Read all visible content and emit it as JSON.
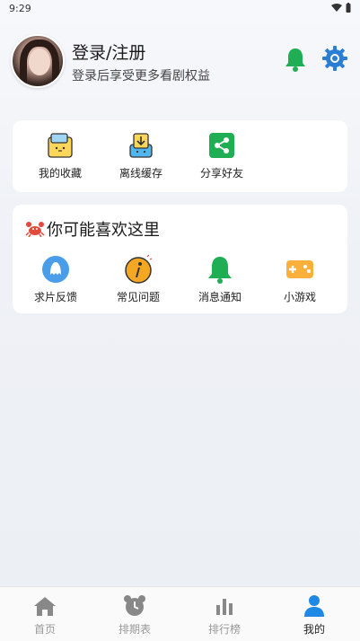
{
  "status_bar": {
    "time": "9:29"
  },
  "profile": {
    "title": "登录/注册",
    "subtitle": "登录后享受更多看剧权益"
  },
  "quick_actions": [
    {
      "label": "我的收藏",
      "icon": "folder-icon"
    },
    {
      "label": "离线缓存",
      "icon": "download-icon"
    },
    {
      "label": "分享好友",
      "icon": "share-icon"
    }
  ],
  "recommend": {
    "title": "你可能喜欢这里",
    "items": [
      {
        "label": "求片反馈",
        "icon": "feedback-icon"
      },
      {
        "label": "常见问题",
        "icon": "info-icon"
      },
      {
        "label": "消息通知",
        "icon": "bell-icon"
      },
      {
        "label": "小游戏",
        "icon": "gamepad-icon"
      }
    ]
  },
  "tabbar": {
    "tabs": [
      {
        "label": "首页",
        "icon": "home-icon"
      },
      {
        "label": "排期表",
        "icon": "alarm-clock-icon"
      },
      {
        "label": "排行榜",
        "icon": "bar-chart-icon"
      },
      {
        "label": "我的",
        "icon": "user-icon"
      }
    ],
    "active_index": 3
  },
  "colors": {
    "accent_green": "#1fae54",
    "accent_blue": "#2a7fd4",
    "active_tab": "#1e88e5"
  }
}
